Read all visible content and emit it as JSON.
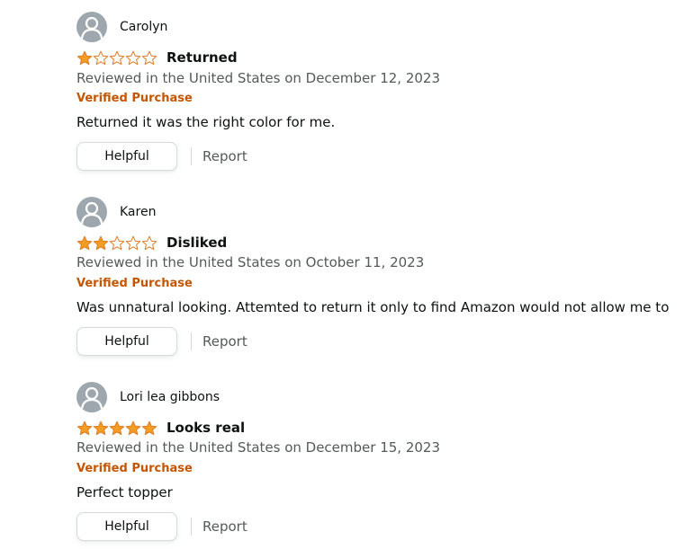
{
  "colors": {
    "star_fill": "#f29e24",
    "star_outline": "#de7921",
    "verified": "#c45500",
    "meta_text": "#565959",
    "avatar_bg": "#9ea7ad"
  },
  "reviews": [
    {
      "reviewer": "Carolyn",
      "rating": 1,
      "rating_max": 5,
      "title": "Returned",
      "date": "Reviewed in the United States on December 12, 2023",
      "verified": "Verified Purchase",
      "body": "Returned it was the right color for me.",
      "helpful_label": "Helpful",
      "report_label": "Report"
    },
    {
      "reviewer": "Karen",
      "rating": 2,
      "rating_max": 5,
      "title": "Disliked",
      "date": "Reviewed in the United States on October 11, 2023",
      "verified": "Verified Purchase",
      "body": "Was unnatural looking. Attemted to return it only to find Amazon would not allow me to",
      "helpful_label": "Helpful",
      "report_label": "Report"
    },
    {
      "reviewer": "Lori lea gibbons",
      "rating": 5,
      "rating_max": 5,
      "title": "Looks real",
      "date": "Reviewed in the United States on December 15, 2023",
      "verified": "Verified Purchase",
      "body": "Perfect topper",
      "helpful_label": "Helpful",
      "report_label": "Report"
    }
  ]
}
